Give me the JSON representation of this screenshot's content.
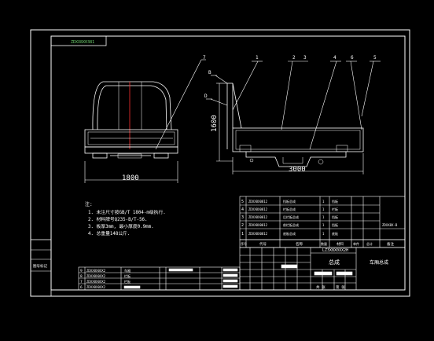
{
  "drawing": {
    "doc_code_tl": "ZDXX8X0381",
    "dims": {
      "width_front": "1800",
      "height_side": "1600",
      "length_side": "3000"
    },
    "callouts": [
      "7",
      "1",
      "2",
      "3",
      "4",
      "6",
      "5",
      "B",
      "D"
    ],
    "notes": [
      "注:",
      "1. 未注尺寸按GB/T 1804-m级执行.",
      "2. 材料牌号Q235-B/T-56.",
      "3. 板厚3mm, 最小厚度0.9mm.",
      "4. 总重量148公斤."
    ],
    "parts_table": {
      "rows": [
        {
          "no": "5",
          "code": "ZDXX8X0812",
          "name": "挡板总成",
          "qty": "1",
          "note": "挡板"
        },
        {
          "no": "4",
          "code": "ZDXX8X0812",
          "name": "栏板总成",
          "qty": "1",
          "note": "栏板"
        },
        {
          "no": "3",
          "code": "ZDXX8X0812",
          "name": "后栏板总成",
          "qty": "1",
          "note": "挡板"
        },
        {
          "no": "2",
          "code": "ZDXX8X0812",
          "name": "前栏板总成",
          "qty": "1",
          "note": "挡板"
        },
        {
          "no": "1",
          "code": "ZDXX8X0812",
          "name": "底板总成",
          "qty": "1",
          "note": "底板"
        }
      ],
      "side_note": "ZDXX8X-B",
      "headers": [
        "序号",
        "代号",
        "名称",
        "数量",
        "材料",
        "单件",
        "总计",
        "备注"
      ]
    },
    "title_block": {
      "drawing_no": "LZ3X8X0XX2H",
      "name": "总成",
      "company": "车厢总成",
      "labels": [
        "共 张",
        "第 张"
      ]
    },
    "bottom_table": {
      "rows": [
        {
          "no": "9",
          "code": "ZDXX8X0XX2",
          "name": "车厢"
        },
        {
          "no": "8",
          "code": "ZDXX8X0XX2",
          "name": "栏板"
        },
        {
          "no": "7",
          "code": "ZDXX8X0XX2",
          "name": "栏板"
        },
        {
          "no": "6",
          "code": "ZDXX8X0XX2",
          "name": ""
        }
      ]
    },
    "left_stamp": "图号标记"
  }
}
